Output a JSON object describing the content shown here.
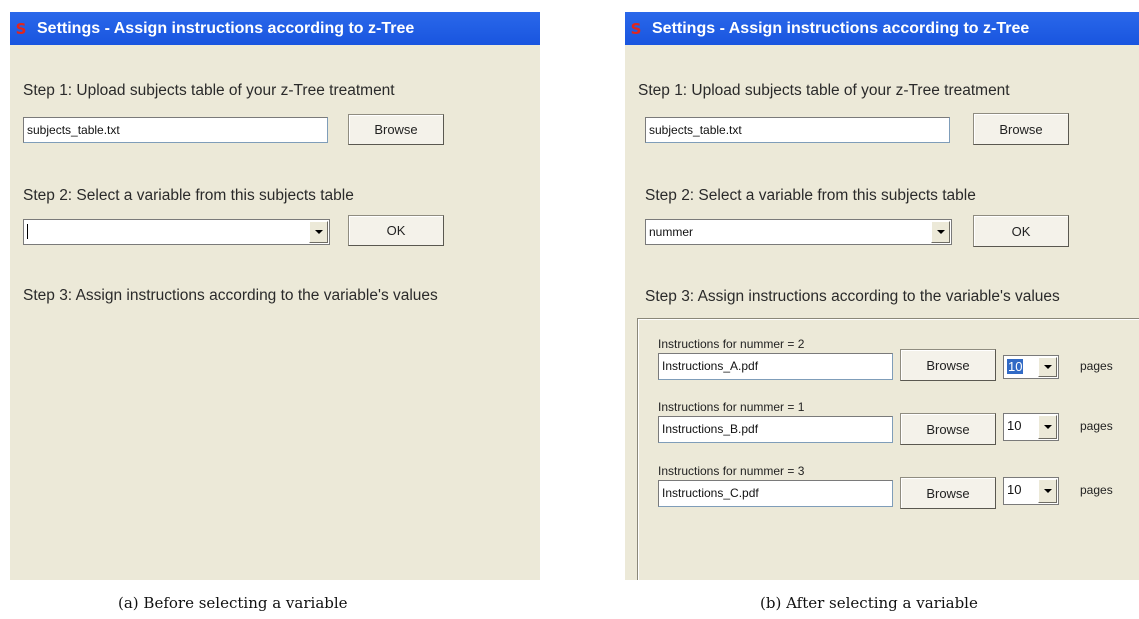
{
  "panel_a": {
    "title": "Settings - Assign instructions according to z-Tree",
    "app_icon_glyph": "S",
    "step1_label": "Step 1: Upload subjects table of your z-Tree treatment",
    "file_value": "subjects_table.txt",
    "browse_label": "Browse",
    "step2_label": "Step 2: Select a variable from this subjects table",
    "variable_value": "",
    "ok_label": "OK",
    "step3_label": "Step 3: Assign instructions according to the variable's values"
  },
  "panel_b": {
    "title": "Settings - Assign instructions according to z-Tree",
    "app_icon_glyph": "S",
    "step1_label": "Step 1: Upload subjects table of your z-Tree treatment",
    "file_value": "subjects_table.txt",
    "browse_label": "Browse",
    "step2_label": "Step 2: Select a variable from this subjects table",
    "variable_value": "nummer",
    "ok_label": "OK",
    "step3_label": "Step 3: Assign instructions according to the variable's values",
    "instructions": [
      {
        "label": "Instructions for nummer = 2",
        "file": "Instructions_A.pdf",
        "browse_label": "Browse",
        "pages_value": "10",
        "pages_label": "pages"
      },
      {
        "label": "Instructions for nummer = 1",
        "file": "Instructions_B.pdf",
        "browse_label": "Browse",
        "pages_value": "10",
        "pages_label": "pages"
      },
      {
        "label": "Instructions for nummer = 3",
        "file": "Instructions_C.pdf",
        "browse_label": "Browse",
        "pages_value": "10",
        "pages_label": "pages"
      }
    ]
  },
  "captions": {
    "a": "(a) Before selecting a variable",
    "b": "(b) After selecting a variable"
  },
  "colors": {
    "titlebar": "#2a68ea",
    "window_bg": "#ece9d8",
    "selection": "#316ac5"
  }
}
